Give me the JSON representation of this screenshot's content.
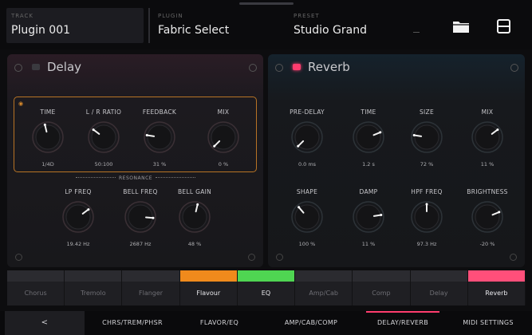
{
  "header": {
    "track_label": "TRACK",
    "track_value": "Plugin 001",
    "plugin_label": "PLUGIN",
    "plugin_value": "Fabric Select",
    "preset_label": "PRESET",
    "preset_value": "Studio Grand",
    "icons": [
      "folder-icon",
      "save-icon"
    ]
  },
  "delay": {
    "title": "Delay",
    "enabled": false,
    "group_label": "RESONANCE",
    "knobs": [
      {
        "label": "TIME",
        "value": "1/4D",
        "level": 0.45
      },
      {
        "label": "L / R RATIO",
        "value": "50:100",
        "level": 0.3
      },
      {
        "label": "FEEDBACK",
        "value": "31 %",
        "level": 0.2
      },
      {
        "label": "MIX",
        "value": "0 %",
        "level": 0.0
      },
      {
        "label": "LP FREQ",
        "value": "19.42 Hz",
        "level": 0.7
      },
      {
        "label": "BELL FREQ",
        "value": "2687 Hz",
        "level": 0.85
      },
      {
        "label": "BELL GAIN",
        "value": "48 %",
        "level": 0.55
      }
    ]
  },
  "reverb": {
    "title": "Reverb",
    "enabled": true,
    "knobs": [
      {
        "label": "PRE-DELAY",
        "value": "0.0 ms",
        "level": 0.0
      },
      {
        "label": "TIME",
        "value": "1.2 s",
        "level": 0.75
      },
      {
        "label": "SIZE",
        "value": "72 %",
        "level": 0.2
      },
      {
        "label": "MIX",
        "value": "11 %",
        "level": 0.7
      },
      {
        "label": "SHAPE",
        "value": "100 %",
        "level": 0.35
      },
      {
        "label": "DAMP",
        "value": "11 %",
        "level": 0.8
      },
      {
        "label": "HPF FREQ",
        "value": "97.3 Hz",
        "level": 0.5
      },
      {
        "label": "BRIGHTNESS",
        "value": "-20 %",
        "level": 0.75
      }
    ]
  },
  "tabs": [
    {
      "label": "Chorus",
      "color": ""
    },
    {
      "label": "Tremolo",
      "color": ""
    },
    {
      "label": "Flanger",
      "color": ""
    },
    {
      "label": "Flavour",
      "color": "#f08a1c"
    },
    {
      "label": "EQ",
      "color": "#4fd552"
    },
    {
      "label": "Amp/Cab",
      "color": ""
    },
    {
      "label": "Comp",
      "color": ""
    },
    {
      "label": "Delay",
      "color": ""
    },
    {
      "label": "Reverb",
      "color": "#ff4f7a"
    }
  ],
  "bottom_nav": [
    {
      "label": "<"
    },
    {
      "label": "CHRS/TREM/PHSR"
    },
    {
      "label": "FLAVOR/EQ"
    },
    {
      "label": "AMP/CAB/COMP"
    },
    {
      "label": "DELAY/REVERB",
      "active": true
    },
    {
      "label": "MIDI SETTINGS"
    }
  ],
  "colors": {
    "accent": "#ff3c6e",
    "group_border": "#b87425"
  }
}
